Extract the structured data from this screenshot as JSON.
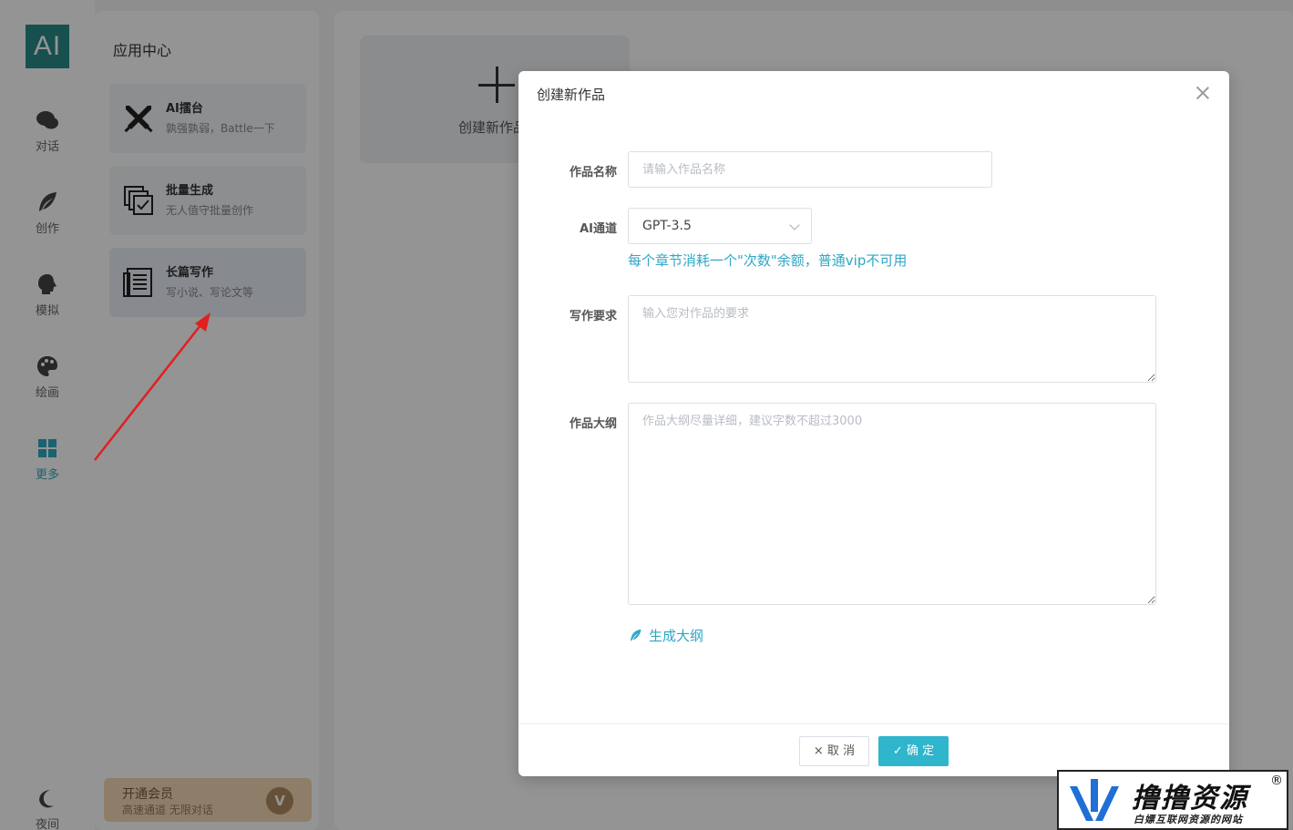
{
  "logo": {
    "text": "AI"
  },
  "rail": {
    "items": [
      {
        "label": "对话",
        "icon": "chat-bubbles-icon"
      },
      {
        "label": "创作",
        "icon": "feather-icon"
      },
      {
        "label": "模拟",
        "icon": "head-profile-icon"
      },
      {
        "label": "绘画",
        "icon": "palette-icon"
      },
      {
        "label": "更多",
        "icon": "grid-icon"
      }
    ],
    "night": {
      "label": "夜间",
      "icon": "moon-icon"
    }
  },
  "app_center": {
    "title": "应用中心",
    "cards": [
      {
        "title": "AI擂台",
        "subtitle": "孰强孰弱，Battle一下",
        "icon": "crossed-swords-icon"
      },
      {
        "title": "批量生成",
        "subtitle": "无人值守批量创作",
        "icon": "batch-check-icon"
      },
      {
        "title": "长篇写作",
        "subtitle": "写小说、写论文等",
        "icon": "document-lines-icon"
      }
    ],
    "vip": {
      "title": "开通会员",
      "subtitle": "高速通道 无限对话",
      "badge": "V"
    }
  },
  "main": {
    "create_label": "创建新作品"
  },
  "modal": {
    "title": "创建新作品",
    "fields": {
      "name": {
        "label": "作品名称",
        "placeholder": "请输入作品名称",
        "value": ""
      },
      "channel": {
        "label": "AI通道",
        "value": "GPT-3.5",
        "hint": "每个章节消耗一个\"次数\"余额，普通vip不可用"
      },
      "requirement": {
        "label": "写作要求",
        "placeholder": "输入您对作品的要求",
        "value": ""
      },
      "outline": {
        "label": "作品大纲",
        "placeholder": "作品大纲尽量详细，建议字数不超过3000",
        "value": ""
      }
    },
    "generate_link": "生成大纲",
    "cancel_label": "× 取 消",
    "ok_label": "✓ 确 定"
  },
  "watermark": {
    "title": "撸撸资源",
    "subtitle": "白嫖互联网资源的网站",
    "reg": "®"
  }
}
